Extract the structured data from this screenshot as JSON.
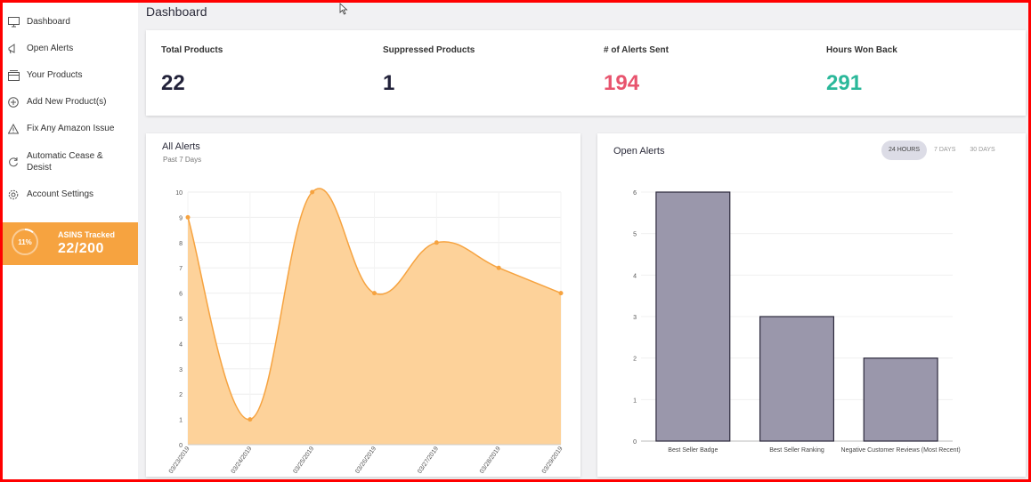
{
  "sidebar": {
    "items": [
      {
        "label": "Dashboard",
        "icon": "monitor-icon"
      },
      {
        "label": "Open Alerts",
        "icon": "megaphone-icon"
      },
      {
        "label": "Your Products",
        "icon": "box-icon"
      },
      {
        "label": "Add New Product(s)",
        "icon": "plus-circle-icon"
      },
      {
        "label": "Fix Any Amazon Issue",
        "icon": "warning-icon"
      },
      {
        "label": "Automatic Cease & Desist",
        "icon": "refresh-icon"
      },
      {
        "label": "Account Settings",
        "icon": "gear-icon"
      }
    ],
    "asins": {
      "percent": "11%",
      "label": "ASINS Tracked",
      "value": "22/200",
      "progress": 0.11
    }
  },
  "page_title": "Dashboard",
  "stats": [
    {
      "label": "Total Products",
      "value": "22",
      "color": "#22223a"
    },
    {
      "label": "Suppressed Products",
      "value": "1",
      "color": "#22223a"
    },
    {
      "label": "# of Alerts Sent",
      "value": "194",
      "color": "#e8546e"
    },
    {
      "label": "Hours Won Back",
      "value": "291",
      "color": "#2bb89a"
    }
  ],
  "all_alerts": {
    "title": "All Alerts",
    "subtitle": "Past 7 Days"
  },
  "open_alerts": {
    "title": "Open Alerts",
    "tabs": [
      "24 HOURS",
      "7 DAYS",
      "30 DAYS"
    ],
    "active_tab": 0
  },
  "colors": {
    "accent": "#f6a340",
    "area_fill": "#fdd29a",
    "bar_fill": "#9a97ab",
    "bar_stroke": "#2d2a3d"
  },
  "chart_data": [
    {
      "type": "area",
      "title": "All Alerts",
      "subtitle": "Past 7 Days",
      "categories": [
        "03/23/2019",
        "03/24/2019",
        "03/25/2019",
        "03/26/2019",
        "03/27/2019",
        "03/28/2019",
        "03/29/2019"
      ],
      "values": [
        9,
        1,
        10,
        6,
        8,
        7,
        6
      ],
      "ylim": [
        0,
        10
      ],
      "yticks": [
        0,
        1,
        2,
        3,
        4,
        5,
        6,
        7,
        8,
        9,
        10
      ],
      "grid": true
    },
    {
      "type": "bar",
      "title": "Open Alerts",
      "categories": [
        "Best Seller Badge",
        "Best Seller Ranking",
        "Negative Customer Reviews (Most Recent)"
      ],
      "values": [
        6,
        3,
        2
      ],
      "ylim": [
        0,
        6
      ],
      "yticks": [
        0,
        1,
        2,
        3,
        4,
        5,
        6
      ],
      "grid": true
    }
  ]
}
